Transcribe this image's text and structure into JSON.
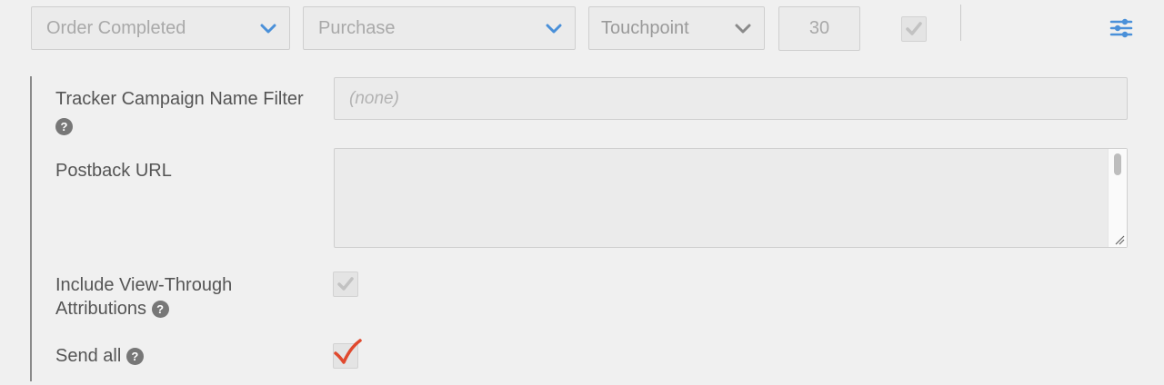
{
  "top_row": {
    "event_select": {
      "value": "Order Completed"
    },
    "type_select": {
      "value": "Purchase"
    },
    "model_select": {
      "value": "Touchpoint"
    },
    "window_input": {
      "value": "30"
    },
    "enabled_checkbox": {
      "checked": true
    },
    "settings_icon": "sliders-icon"
  },
  "form": {
    "campaign_filter": {
      "label": "Tracker Campaign Name Filter",
      "placeholder": "(none)"
    },
    "postback_url": {
      "label": "Postback URL",
      "value": ""
    },
    "view_through": {
      "label_line1": "Include View-Through",
      "label_line2": "Attributions",
      "checked": true
    },
    "send_all": {
      "label": "Send all",
      "checked": true
    }
  },
  "colors": {
    "accent_blue": "#4a90d9",
    "check_red": "#e0492e",
    "help_icon": "#777777"
  }
}
